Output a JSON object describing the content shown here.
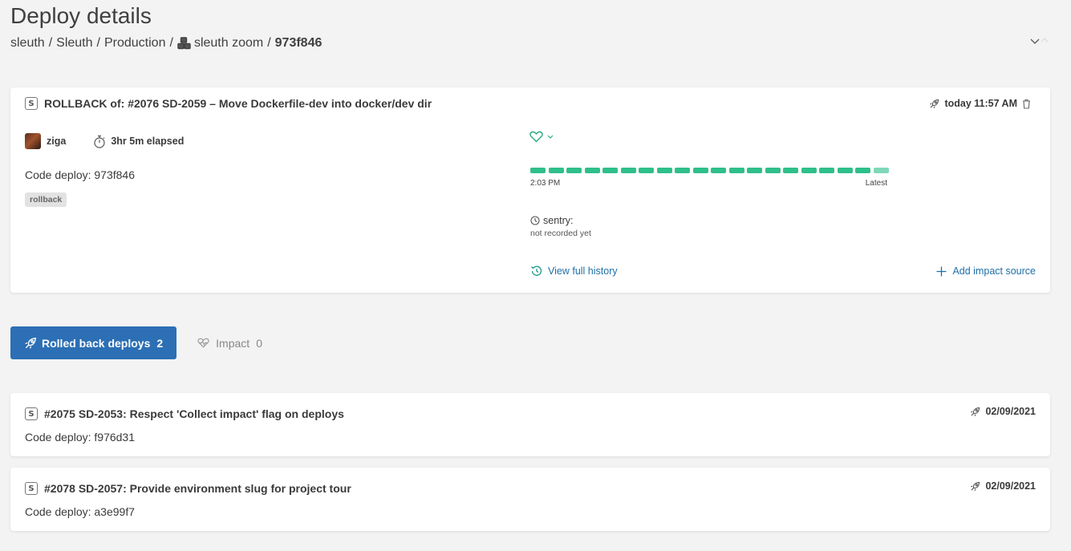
{
  "page": {
    "title": "Deploy details"
  },
  "breadcrumb": {
    "org": "sleuth",
    "project": "Sleuth",
    "environment": "Production",
    "component": "sleuth zoom",
    "sha": "973f846",
    "separator": "/"
  },
  "deploy": {
    "badge": "S",
    "title": "ROLLBACK of: #2076 SD-2059 – Move Dockerfile-dev into docker/dev dir",
    "date": "today 11:57 AM",
    "author": "ziga",
    "elapsed": "3hr 5m elapsed",
    "code_deploy": "Code deploy: 973f846",
    "tag": "rollback",
    "health_status": "healthy",
    "timeline_count": 20,
    "timeline_start": "2:03 PM",
    "timeline_end": "Latest",
    "sentry_label": "sentry:",
    "sentry_status": "not recorded yet",
    "view_history_label": "View full history",
    "add_impact_label": "Add impact source"
  },
  "tabs": [
    {
      "label": "Rolled back deploys",
      "count": "2",
      "active": true,
      "icon": "rocket-icon"
    },
    {
      "label": "Impact",
      "count": "0",
      "active": false,
      "icon": "heart-pulse-icon"
    }
  ],
  "rolled_back": [
    {
      "badge": "S",
      "title": "#2075 SD-2053: Respect 'Collect impact' flag on deploys",
      "date": "02/09/2021",
      "code_deploy": "Code deploy: f976d31"
    },
    {
      "badge": "S",
      "title": "#2078 SD-2057: Provide environment slug for project tour",
      "date": "02/09/2021",
      "code_deploy": "Code deploy: a3e99f7"
    }
  ],
  "colors": {
    "accent": "#2c6fb4",
    "link": "#1e6fa8",
    "healthy": "#2fbf8a",
    "healthy_latest": "#7fd8b8"
  }
}
